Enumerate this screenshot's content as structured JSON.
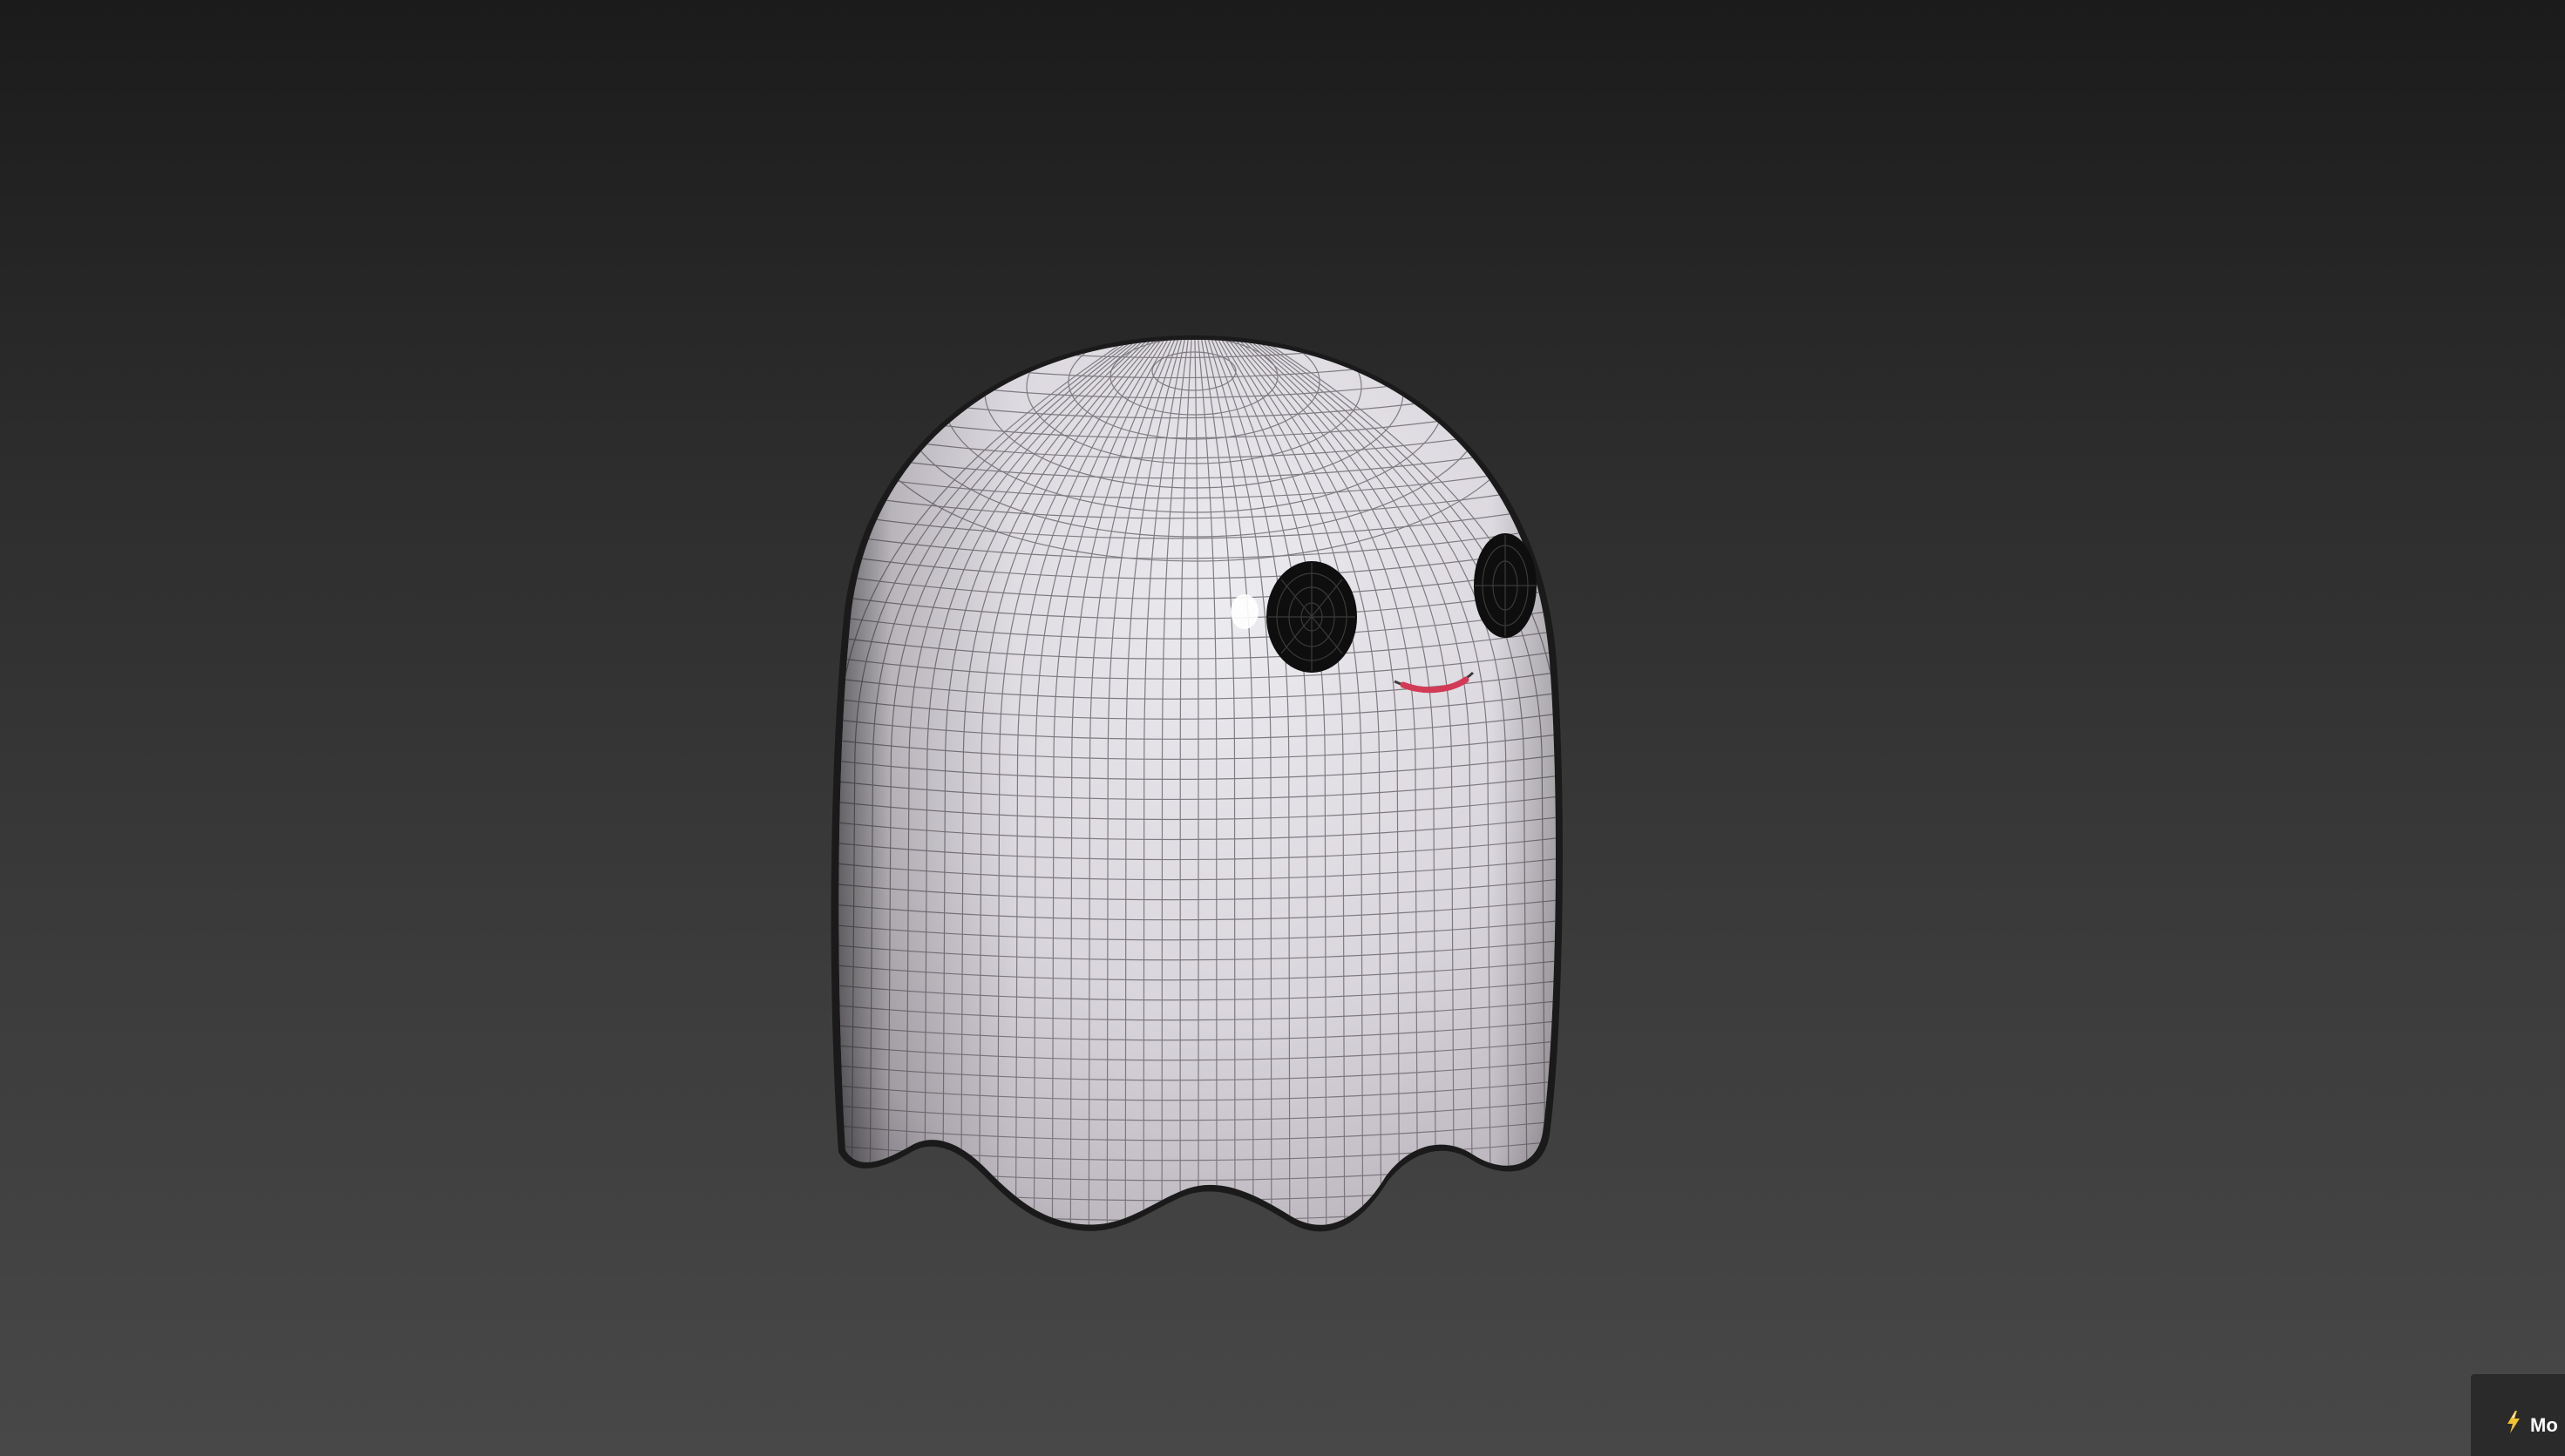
{
  "viewport": {
    "object_name": "ghost",
    "display_mode": "wireframe-on-shaded",
    "background_top": "#1b1b1b",
    "background_bottom": "#484848"
  },
  "model": {
    "body_color": "#e4e0e6",
    "wire_color": "#6e6a70",
    "eye_color": "#0e0e0e",
    "mouth_color": "#d23a55"
  },
  "corner_badge": {
    "icon": "lightning-icon",
    "label": "Mo"
  }
}
